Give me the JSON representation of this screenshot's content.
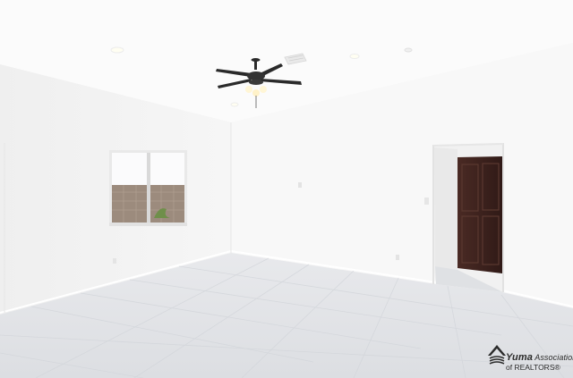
{
  "watermark": {
    "line1_brand": "Yuma",
    "line1_rest": "Association",
    "line2": "of REALTORS®",
    "logo_icon": "house-roof-logo-icon"
  },
  "colors": {
    "ceiling": "#fbfbfb",
    "wall_left": "#f3f3f3",
    "wall_back": "#f7f7f7",
    "floor_tile": "#e3e5e8",
    "door_wood": "#3e2420",
    "fan_blade": "#2a2a2a"
  }
}
